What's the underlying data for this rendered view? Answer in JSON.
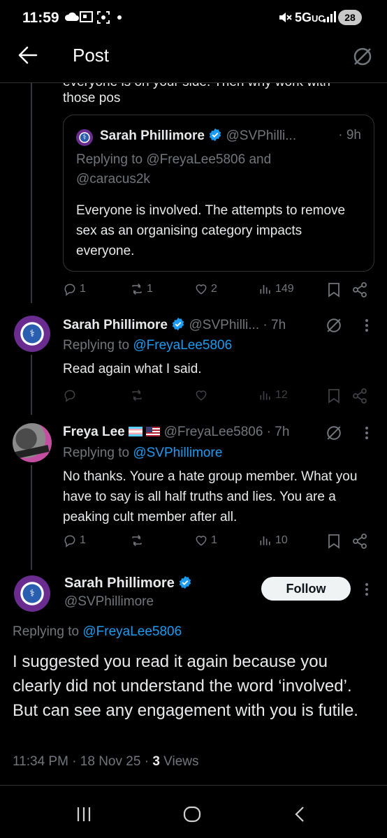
{
  "status_bar": {
    "time": "11:59",
    "network": "5G",
    "network_sub": "UC",
    "battery": "28"
  },
  "header": {
    "title": "Post"
  },
  "thread": {
    "partial_text_top": "everyone is on your side. Then why work with",
    "partial_text_line": "those pos",
    "quote": {
      "name": "Sarah Phillimore",
      "handle": "@SVPhilli...",
      "time": "· 9h",
      "replying_prefix": "Replying to",
      "replying_to": "@FreyaLee5806 and",
      "replying_to2": "@caracus2k",
      "text": "Everyone is involved. The attempts to remove sex as an organising category impacts everyone."
    },
    "actions1": {
      "replies": "1",
      "reposts": "1",
      "likes": "2",
      "views": "149"
    },
    "reply1": {
      "name": "Sarah Phillimore",
      "handle": "@SVPhilli...",
      "time": "· 7h",
      "replying_prefix": "Replying to",
      "replying_to": "@FreyaLee5806",
      "text": "Read again what I said.",
      "views": "12"
    },
    "reply2": {
      "name": "Freya Lee",
      "handle": "@FreyaLee5806 · 7h",
      "replying_prefix": "Replying to",
      "replying_to": "@SVPhillimore",
      "text": "No thanks. Youre a hate group member. What you have to say is all half truths and lies. You are a peaking cult member after all.",
      "replies": "1",
      "likes": "1",
      "views": "10"
    },
    "main": {
      "name": "Sarah Phillimore",
      "handle": "@SVPhillimore",
      "follow_label": "Follow",
      "replying_prefix": "Replying to",
      "replying_to": "@FreyaLee5806",
      "text": "I suggested you read it again because you clearly did not understand the word ‘involved’. But can see any engagement with you is futile.",
      "timestamp": "11:34 PM · 18 Nov 25 · ",
      "views_count": "3",
      "views_label": "Views"
    }
  },
  "colors": {
    "background": "#000000",
    "text": "#e7e9ea",
    "muted": "#71767b",
    "link": "#1d9bf0",
    "verified": "#1d9bf0"
  }
}
